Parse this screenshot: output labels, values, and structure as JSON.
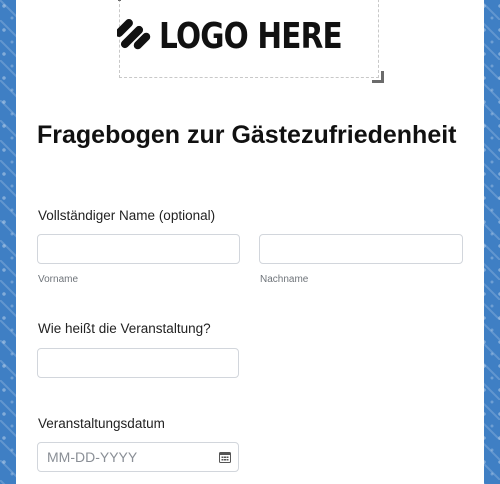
{
  "logo": {
    "text": "LOGO HERE",
    "icon": "logo-placeholder-icon"
  },
  "form": {
    "title": "Fragebogen zur Gästezufriedenheit",
    "fields": {
      "full_name": {
        "label": "Vollständiger Name (optional)",
        "first_value": "",
        "last_value": "",
        "first_sublabel": "Vorname",
        "last_sublabel": "Nachname"
      },
      "event": {
        "label": "Wie heißt die Veranstaltung?",
        "value": ""
      },
      "event_date": {
        "label": "Veranstaltungsdatum",
        "placeholder": "MM-DD-YYYY",
        "icon": "calendar-icon"
      }
    }
  },
  "colors": {
    "background": "#3f7fc4",
    "card": "#ffffff",
    "input_border": "#d2d6dc",
    "text": "#111111"
  }
}
